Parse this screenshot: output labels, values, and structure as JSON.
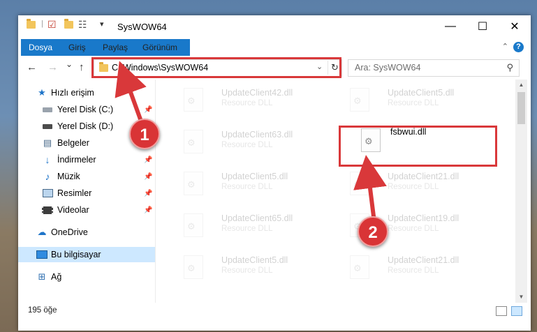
{
  "window": {
    "title": "SysWOW64",
    "controls": {
      "minimize": "—",
      "maximize": "☐",
      "close": "✕"
    }
  },
  "ribbon": {
    "tabs": [
      "Dosya",
      "Giriş",
      "Paylaş",
      "Görünüm"
    ],
    "help": "?"
  },
  "nav": {
    "back": "←",
    "forward": "→",
    "recent": "⌄",
    "up": "↑",
    "address": "C:\\Windows\\SysWOW64",
    "search_placeholder": "Ara: SysWOW64"
  },
  "sidebar": {
    "items": [
      {
        "label": "Hızlı erişim",
        "icon": "star-icon",
        "pinned": false
      },
      {
        "label": "Yerel Disk (C:)",
        "icon": "drive-icon",
        "pinned": true
      },
      {
        "label": "Yerel Disk (D:)",
        "icon": "drive-icon",
        "pinned": true
      },
      {
        "label": "Belgeler",
        "icon": "document-icon",
        "pinned": true
      },
      {
        "label": "İndirmeler",
        "icon": "download-icon",
        "pinned": true
      },
      {
        "label": "Müzik",
        "icon": "music-icon",
        "pinned": true
      },
      {
        "label": "Resimler",
        "icon": "pictures-icon",
        "pinned": true
      },
      {
        "label": "Videolar",
        "icon": "video-icon",
        "pinned": true
      },
      {
        "label": "OneDrive",
        "icon": "cloud-icon",
        "pinned": false
      },
      {
        "label": "Bu bilgisayar",
        "icon": "computer-icon",
        "pinned": false,
        "selected": true
      },
      {
        "label": "Ağ",
        "icon": "network-icon",
        "pinned": false
      }
    ]
  },
  "files": [
    {
      "name": "UpdateClient42.dll",
      "type": "Resource DLL",
      "highlight": false
    },
    {
      "name": "UpdateClient5.dll",
      "type": "Resource DLL",
      "highlight": false
    },
    {
      "name": "UpdateClient63.dll",
      "type": "Resource DLL",
      "highlight": false
    },
    {
      "name": "fsbwui.dll",
      "type": "",
      "highlight": true
    },
    {
      "name": "UpdateClient5.dll",
      "type": "Resource DLL",
      "highlight": false
    },
    {
      "name": "UpdateClient21.dll",
      "type": "Resource DLL",
      "highlight": false
    },
    {
      "name": "UpdateClient65.dll",
      "type": "Resource DLL",
      "highlight": false
    },
    {
      "name": "UpdateClient19.dll",
      "type": "Resource DLL",
      "highlight": false
    },
    {
      "name": "UpdateClient5.dll",
      "type": "Resource DLL",
      "highlight": false
    },
    {
      "name": "UpdateClient21.dll",
      "type": "Resource DLL",
      "highlight": false
    }
  ],
  "status": {
    "count": "195 öğe"
  },
  "annotations": {
    "step1": "1",
    "step2": "2",
    "color": "#d9383a"
  }
}
